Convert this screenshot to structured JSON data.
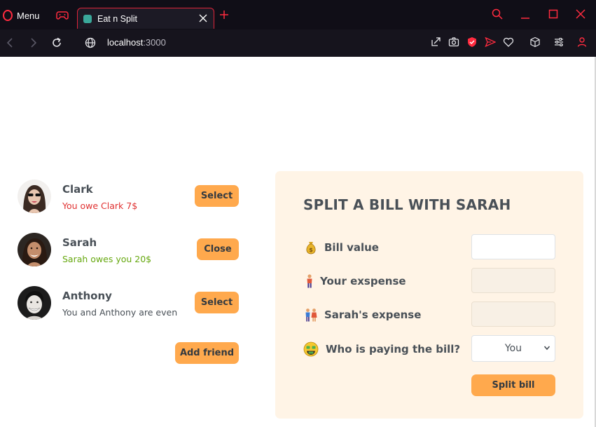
{
  "browser": {
    "menu_label": "Menu",
    "tab_title": "Eat n Split",
    "url_host": "localhost",
    "url_rest": ":3000",
    "accent_color": "#e0243a"
  },
  "friends": [
    {
      "name": "Clark",
      "status": "You owe Clark 7$",
      "status_kind": "negative",
      "button": "Select"
    },
    {
      "name": "Sarah",
      "status": "Sarah owes you 20$",
      "status_kind": "positive",
      "button": "Close"
    },
    {
      "name": "Anthony",
      "status": "You and Anthony are even",
      "status_kind": "even",
      "button": "Select"
    }
  ],
  "add_friend_label": "Add friend",
  "split": {
    "title": "SPLIT A BILL WITH SARAH",
    "bill_value_label": "Bill value",
    "bill_value": "",
    "your_expense_label": "Your exspense",
    "friend_expense_label": "Sarah's expense",
    "payer_label": "Who is paying the bill?",
    "payer_value": "You",
    "submit_label": "Split bill"
  },
  "icons": {
    "bill_value": "money-bag-icon",
    "your_expense": "person-standing-icon",
    "friend_expense": "couple-icon",
    "payer": "money-mouth-face-icon"
  },
  "colors": {
    "button": "#ffa94d",
    "panel": "#fff4e6",
    "owe": "#e03131",
    "owed": "#66a80f"
  }
}
